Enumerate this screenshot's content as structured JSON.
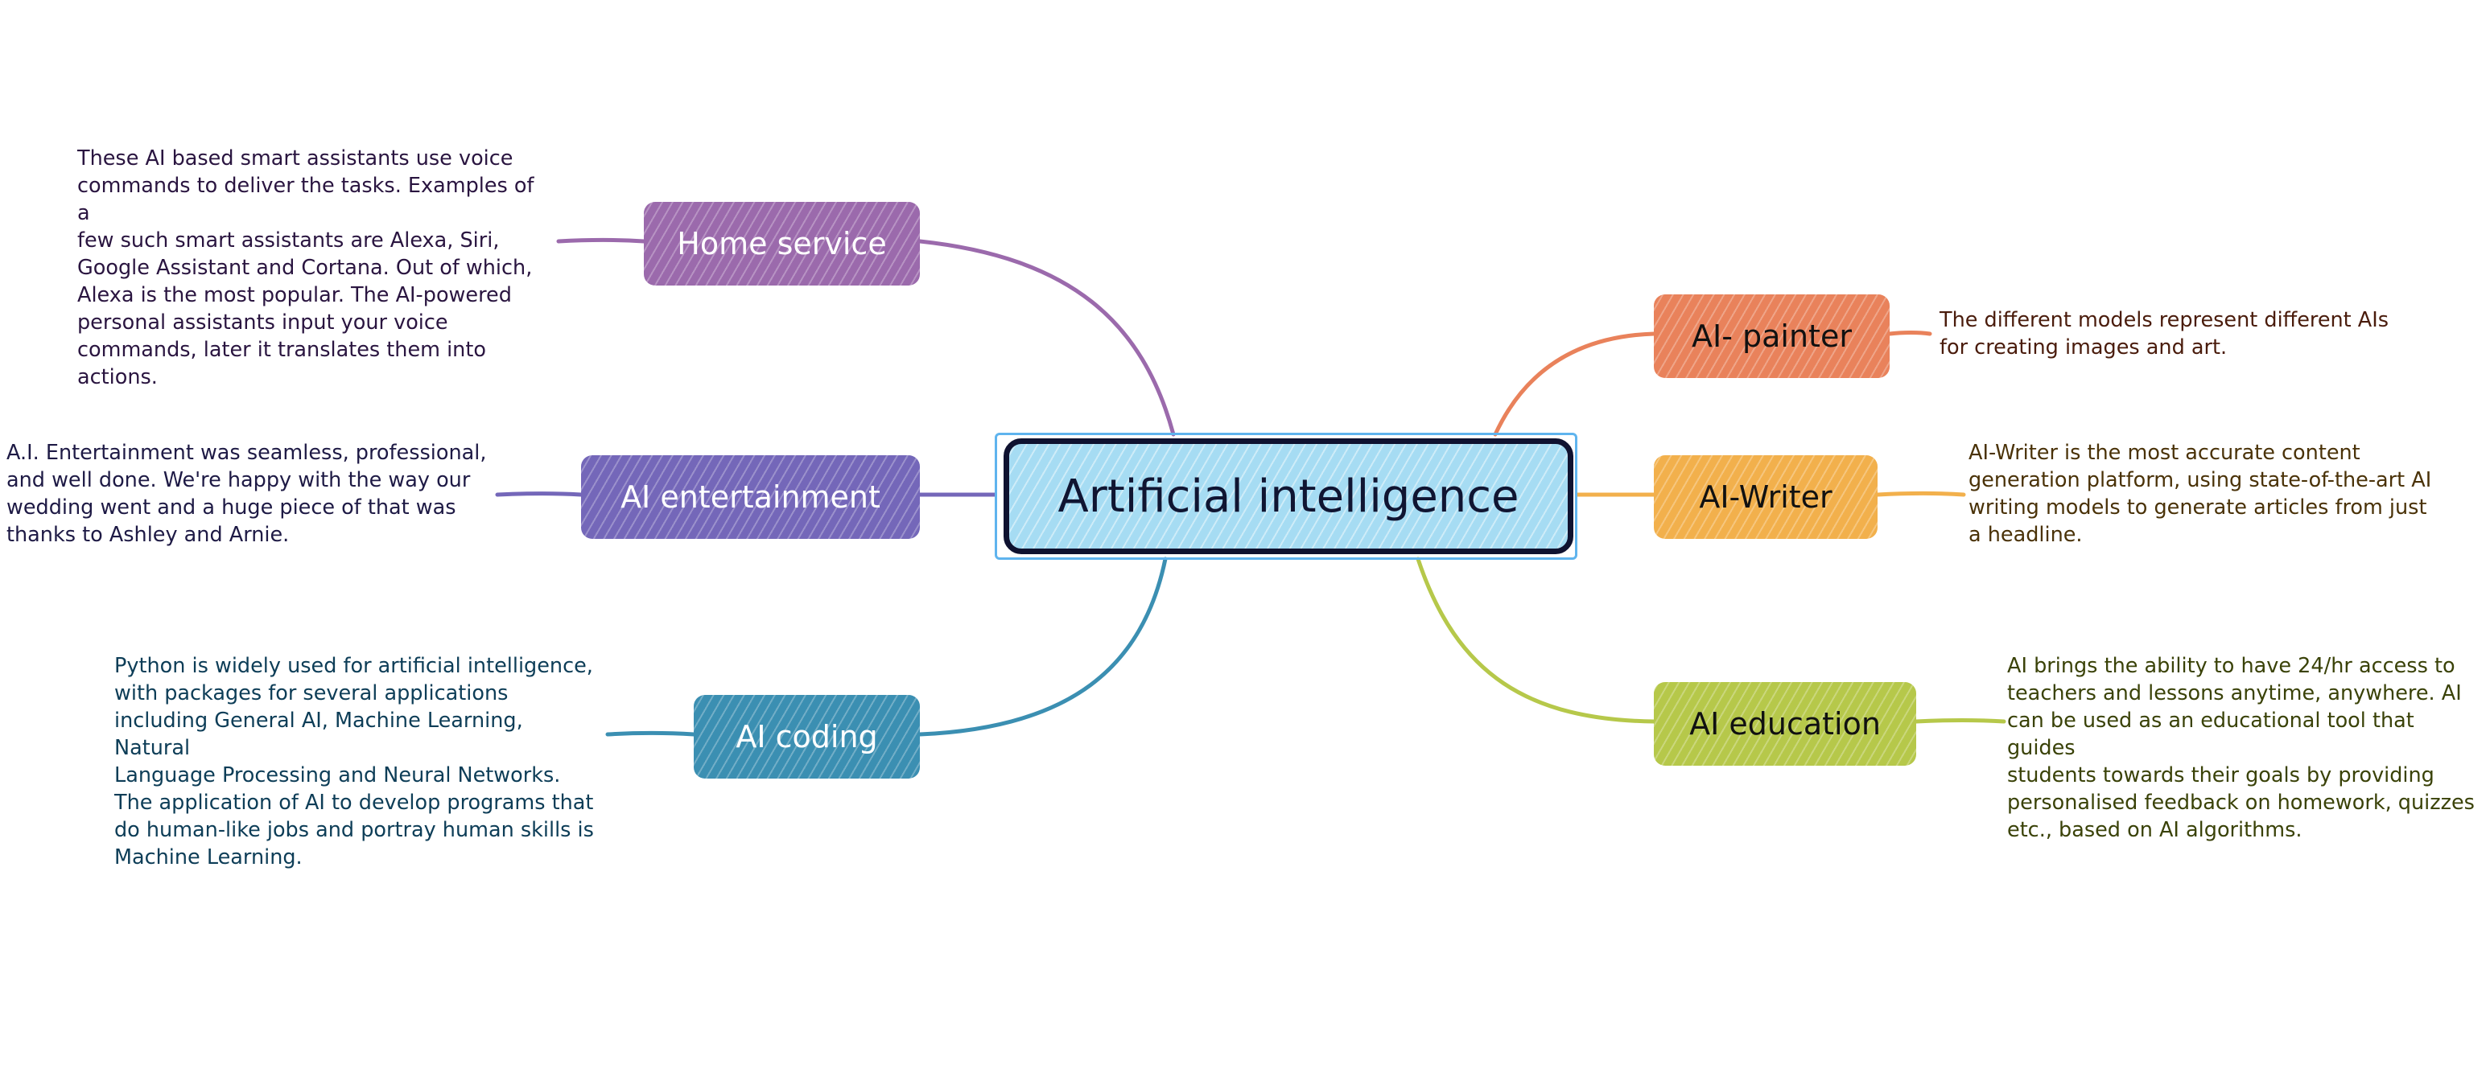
{
  "central": {
    "title": "Artificial intelligence",
    "color": "#a6dcf3",
    "border_color": "#0f1230"
  },
  "branches": [
    {
      "id": "home-service",
      "label": "Home service",
      "color": "#9b6aac",
      "side": "left",
      "description": "These AI based smart assistants use voice\ncommands to deliver the tasks. Examples of a\nfew such smart assistants are Alexa, Siri,\nGoogle Assistant and Cortana. Out of which,\nAlexa is the most popular. The AI-powered\npersonal assistants input your voice\ncommands, later it translates them into\nactions.",
      "description_color": "#2a1540"
    },
    {
      "id": "ai-entertainment",
      "label": "AI entertainment",
      "color": "#7467b9",
      "side": "left",
      "description": "A.I. Entertainment was seamless, professional,\nand well done. We're happy with the way our\nwedding went and a huge piece of that was\nthanks to Ashley and Arnie.",
      "description_color": "#1e1a45"
    },
    {
      "id": "ai-coding",
      "label": "AI coding",
      "color": "#3b8fb2",
      "side": "left",
      "description": "Python is widely used for artificial intelligence,\nwith packages for several applications\nincluding General AI, Machine Learning, Natural\nLanguage Processing and Neural Networks.\nThe application of AI to develop programs that\ndo human-like jobs and portray human skills is\nMachine Learning.",
      "description_color": "#0d3d57"
    },
    {
      "id": "ai-painter",
      "label": "AI- painter",
      "color": "#e9825b",
      "side": "right",
      "description": "The different models represent different AIs\nfor creating images and art.",
      "description_color": "#4a1c0c"
    },
    {
      "id": "ai-writer",
      "label": "AI-Writer",
      "color": "#f2b04c",
      "side": "right",
      "description": "AI-Writer is the most accurate content\ngeneration platform, using state-of-the-art AI\nwriting models to generate articles from just\na headline.",
      "description_color": "#4a3208"
    },
    {
      "id": "ai-education",
      "label": "AI education",
      "color": "#b6c84a",
      "side": "right",
      "description": "AI brings the ability to have 24/hr access to\nteachers and lessons anytime, anywhere. AI\ncan be used as an educational tool that guides\nstudents towards their goals by providing\npersonalised feedback on homework, quizzes\netc., based on AI algorithms.",
      "description_color": "#3a4208"
    }
  ]
}
